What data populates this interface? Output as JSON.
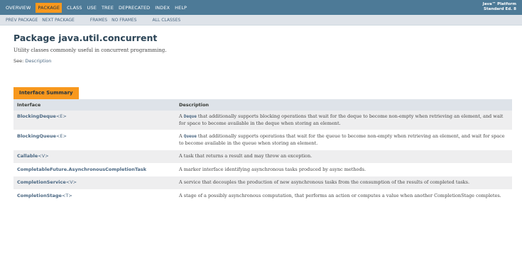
{
  "top_nav": {
    "items": [
      "OVERVIEW",
      "PACKAGE",
      "CLASS",
      "USE",
      "TREE",
      "DEPRECATED",
      "INDEX",
      "HELP"
    ],
    "active": "PACKAGE",
    "about_line1": "Java™ Platform",
    "about_line2": "Standard Ed. 8"
  },
  "sub_nav": {
    "prev": "PREV PACKAGE",
    "next": "NEXT PACKAGE",
    "frames": "FRAMES",
    "no_frames": "NO FRAMES",
    "all_classes": "ALL CLASSES"
  },
  "header": {
    "title": "Package java.util.concurrent",
    "description": "Utility classes commonly useful in concurrent programming.",
    "see_label": "See:",
    "see_link": "Description"
  },
  "summary": {
    "caption": "Interface Summary",
    "col1": "Interface",
    "col2": "Description",
    "rows": [
      {
        "name": "BlockingDeque",
        "type": "<E>",
        "pre": "A ",
        "code": "Deque",
        "post": " that additionally supports blocking operations that wait for the deque to become non-empty when retrieving an element, and wait for space to become available in the deque when storing an element."
      },
      {
        "name": "BlockingQueue",
        "type": "<E>",
        "pre": "A ",
        "code": "Queue",
        "post": " that additionally supports operations that wait for the queue to become non-empty when retrieving an element, and wait for space to become available in the queue when storing an element."
      },
      {
        "name": "Callable",
        "type": "<V>",
        "pre": "A task that returns a result and may throw an exception.",
        "code": "",
        "post": ""
      },
      {
        "name": "CompletableFuture.AsynchronousCompletionTask",
        "type": "",
        "pre": "A marker interface identifying asynchronous tasks produced by async methods.",
        "code": "",
        "post": ""
      },
      {
        "name": "CompletionService",
        "type": "<V>",
        "pre": "A service that decouples the production of new asynchronous tasks from the consumption of the results of completed tasks.",
        "code": "",
        "post": ""
      },
      {
        "name": "CompletionStage",
        "type": "<T>",
        "pre": "A stage of a possibly asynchronous computation, that performs an action or computes a value when another CompletionStage completes.",
        "code": "",
        "post": ""
      }
    ]
  },
  "colors": {
    "nav_bg": "#4d7a97",
    "accent": "#f8981d",
    "subnav_bg": "#dee3e9",
    "link": "#4a6782",
    "alt_row": "#eeeeef"
  }
}
